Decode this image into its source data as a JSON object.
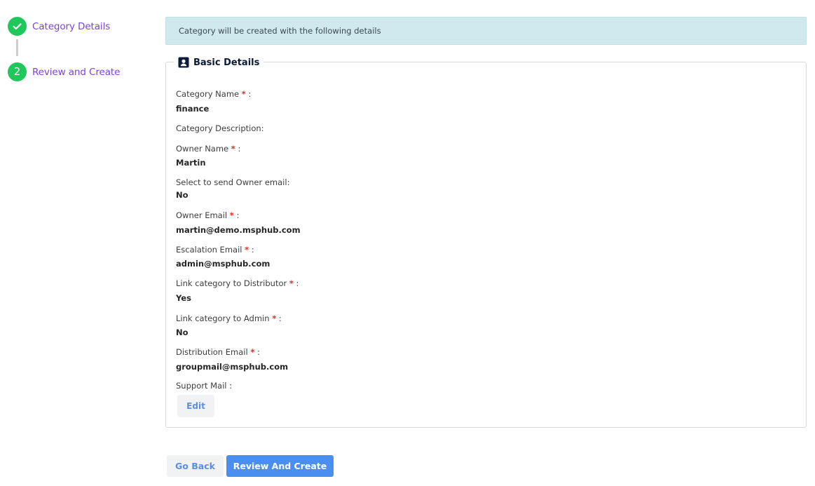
{
  "stepper": {
    "steps": [
      {
        "label": "Category Details",
        "status": "completed",
        "icon": "check-icon"
      },
      {
        "label": "Review and Create",
        "number": "2",
        "status": "current"
      }
    ],
    "accent_color": "#1ec85b",
    "label_color": "#7c42d6"
  },
  "banner": {
    "text": "Category will be created with the following details"
  },
  "section": {
    "title": "Basic Details",
    "icon": "contact-card-icon"
  },
  "fields": [
    {
      "label": "Category Name",
      "required": "*",
      "suffix": " :",
      "value": "finance"
    },
    {
      "label": "Category Description:",
      "required": "",
      "suffix": "",
      "value": ""
    },
    {
      "label": "Owner Name",
      "required": "*",
      "suffix": " :",
      "value": "Martin"
    },
    {
      "label": "Select to send Owner email:",
      "required": "",
      "suffix": "",
      "value": "No"
    },
    {
      "label": "Owner Email",
      "required": "*",
      "suffix": " :",
      "value": "martin@demo.msphub.com"
    },
    {
      "label": "Escalation Email",
      "required": "*",
      "suffix": " :",
      "value": "admin@msphub.com"
    },
    {
      "label": "Link category to Distributor",
      "required": "*",
      "suffix": " :",
      "value": "Yes"
    },
    {
      "label": "Link category to Admin",
      "required": "*",
      "suffix": " :",
      "value": "No"
    },
    {
      "label": "Distribution Email",
      "required": "*",
      "suffix": " :",
      "value": "groupmail@msphub.com"
    },
    {
      "label": "Support Mail :",
      "required": "",
      "suffix": "",
      "value": ""
    }
  ],
  "actions": {
    "edit_label": "Edit",
    "back_label": "Go Back",
    "create_label": "Review And Create"
  }
}
